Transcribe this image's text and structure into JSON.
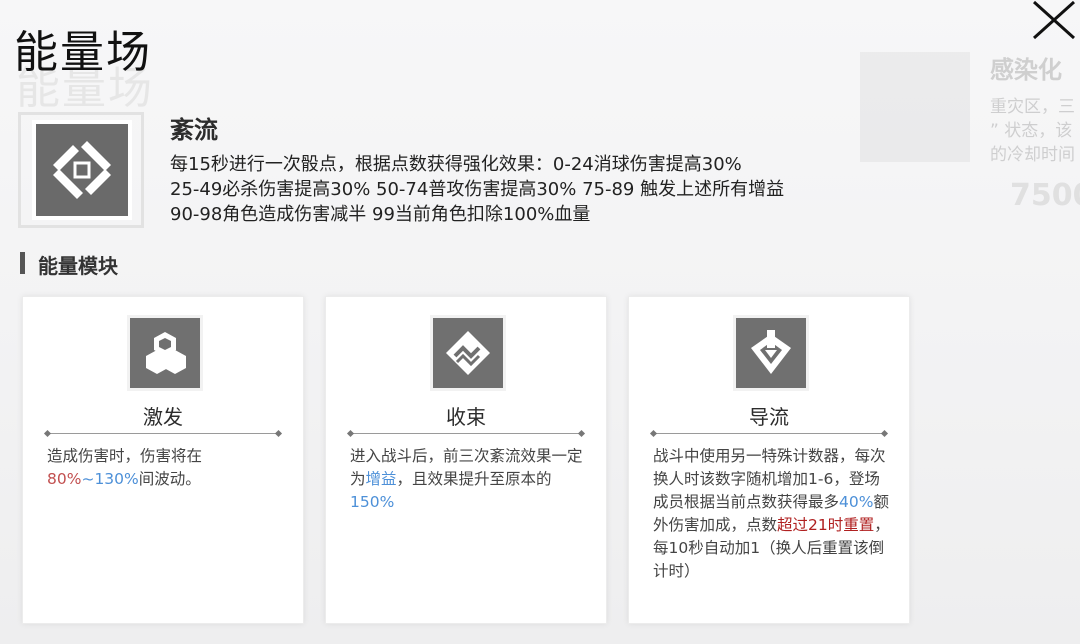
{
  "page": {
    "title": "能量场"
  },
  "background_panel": {
    "title": "感染化",
    "lines": [
      "重灾区，三",
      "” 状态，该",
      "的冷却时间"
    ],
    "number": "7500"
  },
  "field": {
    "name": "紊流",
    "desc_lines": [
      "每15秒进行一次骰点，根据点数获得强化效果：0-24消球伤害提高30%",
      "25-49必杀伤害提高30% 50-74普攻伤害提高30% 75-89 触发上述所有增益",
      "90-98角色造成伤害减半 99当前角色扣除100%血量"
    ]
  },
  "section": {
    "title": "能量模块"
  },
  "modules": [
    {
      "name": "激发",
      "desc": {
        "p1": "造成伤害时，伤害将在",
        "h1": "80%",
        "h2": "~130%",
        "p2": "间波动。"
      }
    },
    {
      "name": "收束",
      "desc": {
        "p1": "进入战斗后，前三次紊流效果一定为",
        "h1": "增益",
        "p2": "，且效果提升至原本的",
        "h2": "150%"
      }
    },
    {
      "name": "导流",
      "desc": {
        "p1": "战斗中使用另一特殊计数器，每次换人时该数字随机增加1-6，登场成员根据当前点数获得最多",
        "h1": "40%",
        "p2": "额外伤害加成，点数",
        "h2": "超过21时重置",
        "p3": "，每10秒自动加1（换人后重置该倒计时）"
      }
    }
  ],
  "colors": {
    "highlight_blue": "#4d90d8",
    "highlight_red": "#c25050",
    "highlight_darkred": "#b02020",
    "icon_bg": "#707070"
  }
}
